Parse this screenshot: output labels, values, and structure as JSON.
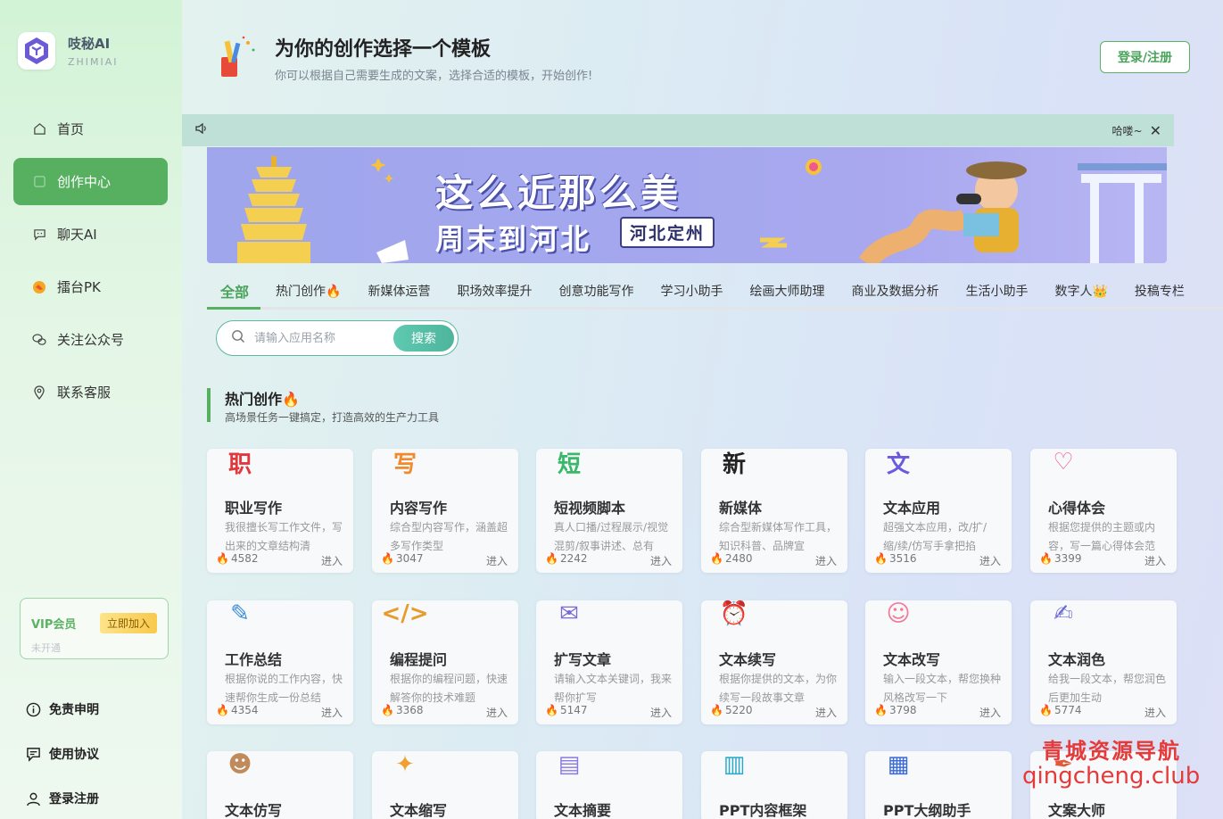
{
  "app": {
    "name": "吱秘AI",
    "sub": "ZHIMIAI"
  },
  "nav": [
    {
      "label": "首页",
      "icon": "home-icon",
      "active": false
    },
    {
      "label": "创作中心",
      "icon": "create-icon",
      "active": true
    },
    {
      "label": "聊天AI",
      "icon": "chat-icon",
      "active": false
    },
    {
      "label": "擂台PK",
      "icon": "pk-icon",
      "active": false
    },
    {
      "label": "关注公众号",
      "icon": "wechat-icon",
      "active": false
    },
    {
      "label": "联系客服",
      "icon": "location-icon",
      "active": false
    }
  ],
  "vip": {
    "label": "VIP会员",
    "button": "立即加入",
    "status": "未开通"
  },
  "bottom_links": [
    {
      "label": "免责申明",
      "icon": "info-icon"
    },
    {
      "label": "使用协议",
      "icon": "agreement-icon"
    },
    {
      "label": "登录注册",
      "icon": "user-icon"
    }
  ],
  "header": {
    "title": "为你的创作选择一个模板",
    "subtitle": "你可以根据自己需要生成的文案，选择合适的模板，开始创作!",
    "login": "登录/注册"
  },
  "notice": {
    "text": "哈喽~"
  },
  "banner": {
    "line1": "这么近那么美",
    "line2": "周末到河北",
    "tag": "河北定州"
  },
  "tabs": [
    "全部",
    "热门创作🔥",
    "新媒体运营",
    "职场效率提升",
    "创意功能写作",
    "学习小助手",
    "绘画大师助理",
    "商业及数据分析",
    "生活小助手",
    "数字人👑",
    "投稿专栏"
  ],
  "search": {
    "placeholder": "请输入应用名称",
    "button": "搜索"
  },
  "section": {
    "title": "热门创作🔥",
    "subtitle": "高场景任务一键搞定，打造高效的生产力工具"
  },
  "cards": [
    {
      "title": "职业写作",
      "desc": "我很擅长写工作文件，写出来的文章结构清",
      "count": "4582",
      "icon": "job-icon",
      "glyph": "职",
      "color": "#e2383c"
    },
    {
      "title": "内容写作",
      "desc": "综合型内容写作，涵盖超多写作类型",
      "count": "3047",
      "icon": "write-icon",
      "glyph": "写",
      "color": "#f08a2c"
    },
    {
      "title": "短视频脚本",
      "desc": "真人口播/过程展示/视觉混剪/叙事讲述、总有",
      "count": "2242",
      "icon": "video-script-icon",
      "glyph": "短",
      "color": "#3ab86a"
    },
    {
      "title": "新媒体",
      "desc": "综合型新媒体写作工具，知识科普、品牌宣",
      "count": "2480",
      "icon": "new-media-icon",
      "glyph": "新",
      "color": "#222222"
    },
    {
      "title": "文本应用",
      "desc": "超强文本应用，改/扩/缩/续/仿写手拿把掐",
      "count": "3516",
      "icon": "text-app-icon",
      "glyph": "文",
      "color": "#6a5ae0"
    },
    {
      "title": "心得体会",
      "desc": "根据您提供的主题或内容，写一篇心得体会范",
      "count": "3399",
      "icon": "heart-icon",
      "glyph": "♡",
      "color": "#f05a8a"
    },
    {
      "title": "工作总结",
      "desc": "根据你说的工作内容，快速帮你生成一份总结",
      "count": "4354",
      "icon": "summary-icon",
      "glyph": "✎",
      "color": "#3a8ad8"
    },
    {
      "title": "编程提问",
      "desc": "根据你的编程问题，快速解答你的技术难题",
      "count": "3368",
      "icon": "code-icon",
      "glyph": "</>",
      "color": "#e89a2a"
    },
    {
      "title": "扩写文章",
      "desc": "请输入文本关键词，我来帮你扩写",
      "count": "5147",
      "icon": "expand-icon",
      "glyph": "✉",
      "color": "#7a6ad8"
    },
    {
      "title": "文本续写",
      "desc": "根据你提供的文本，为你续写一段故事文章",
      "count": "5220",
      "icon": "continue-icon",
      "glyph": "⏰",
      "color": "#3a9ad8"
    },
    {
      "title": "文本改写",
      "desc": "输入一段文本，帮您换种风格改写一下",
      "count": "3798",
      "icon": "rewrite-icon",
      "glyph": "☺",
      "color": "#f07a9a"
    },
    {
      "title": "文本润色",
      "desc": "给我一段文本，帮您润色后更加生动",
      "count": "5774",
      "icon": "polish-icon",
      "glyph": "✍",
      "color": "#6a6ad8"
    },
    {
      "title": "文本仿写",
      "desc": "",
      "count": "",
      "icon": "imitate-icon",
      "glyph": "☻",
      "color": "#c08a5a"
    },
    {
      "title": "文本缩写",
      "desc": "",
      "count": "",
      "icon": "abbreviate-icon",
      "glyph": "✦",
      "color": "#f0a030"
    },
    {
      "title": "文本摘要",
      "desc": "",
      "count": "",
      "icon": "abstract-icon",
      "glyph": "▤",
      "color": "#8a7ae0"
    },
    {
      "title": "PPT内容框架",
      "desc": "",
      "count": "",
      "icon": "ppt-frame-icon",
      "glyph": "▥",
      "color": "#2aa8c8"
    },
    {
      "title": "PPT大纲助手",
      "desc": "",
      "count": "",
      "icon": "ppt-outline-icon",
      "glyph": "▦",
      "color": "#3a6ad8"
    },
    {
      "title": "文案大师",
      "desc": "",
      "count": "",
      "icon": "copy-master-icon",
      "glyph": "✒",
      "color": "#e05a3a"
    }
  ],
  "card_enter": "进入",
  "watermark": {
    "line1": "青城资源导航",
    "line2": "qingcheng.club"
  }
}
